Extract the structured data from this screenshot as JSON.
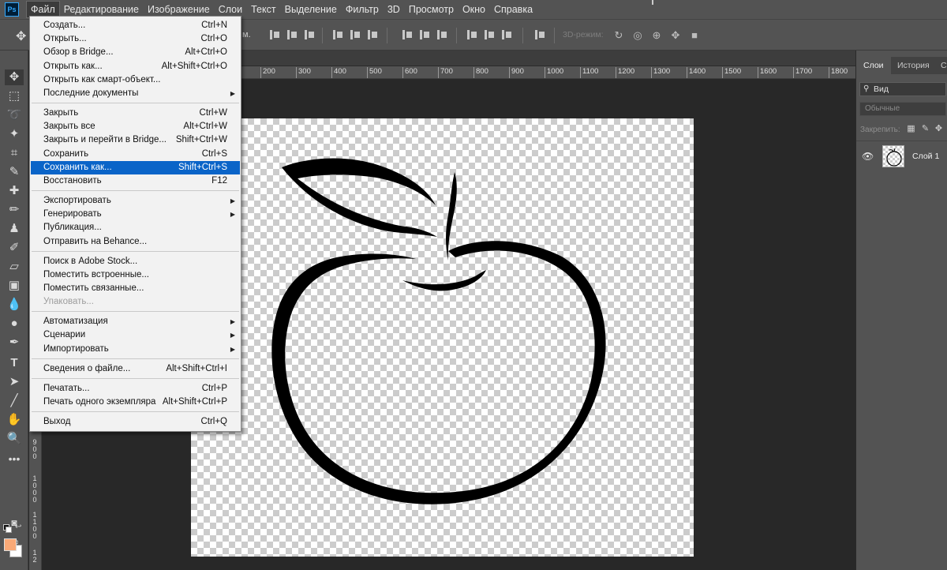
{
  "app": {
    "logo_text": "Ps"
  },
  "menubar": {
    "items": [
      "Файл",
      "Редактирование",
      "Изображение",
      "Слои",
      "Текст",
      "Выделение",
      "Фильтр",
      "3D",
      "Просмотр",
      "Окно",
      "Справка"
    ],
    "active_index": 0
  },
  "options_bar": {
    "dot_label": "м.",
    "mode_3d_label": "3D-режим:"
  },
  "file_menu": {
    "items": [
      {
        "label": "Создать...",
        "shortcut": "Ctrl+N"
      },
      {
        "label": "Открыть...",
        "shortcut": "Ctrl+O"
      },
      {
        "label": "Обзор в Bridge...",
        "shortcut": "Alt+Ctrl+O"
      },
      {
        "label": "Открыть как...",
        "shortcut": "Alt+Shift+Ctrl+O"
      },
      {
        "label": "Открыть как смарт-объект...",
        "shortcut": ""
      },
      {
        "label": "Последние документы",
        "shortcut": "",
        "submenu": true
      },
      {
        "label": "Закрыть",
        "shortcut": "Ctrl+W"
      },
      {
        "label": "Закрыть все",
        "shortcut": "Alt+Ctrl+W"
      },
      {
        "label": "Закрыть и перейти в Bridge...",
        "shortcut": "Shift+Ctrl+W"
      },
      {
        "label": "Сохранить",
        "shortcut": "Ctrl+S"
      },
      {
        "label": "Сохранить как...",
        "shortcut": "Shift+Ctrl+S",
        "highlighted": true
      },
      {
        "label": "Восстановить",
        "shortcut": "F12"
      },
      {
        "label": "Экспортировать",
        "shortcut": "",
        "submenu": true
      },
      {
        "label": "Генерировать",
        "shortcut": "",
        "submenu": true
      },
      {
        "label": "Публикация...",
        "shortcut": ""
      },
      {
        "label": "Отправить на Behance...",
        "shortcut": ""
      },
      {
        "label": "Поиск в Adobe Stock...",
        "shortcut": ""
      },
      {
        "label": "Поместить встроенные...",
        "shortcut": ""
      },
      {
        "label": "Поместить связанные...",
        "shortcut": ""
      },
      {
        "label": "Упаковать...",
        "shortcut": "",
        "disabled": true
      },
      {
        "label": "Автоматизация",
        "shortcut": "",
        "submenu": true
      },
      {
        "label": "Сценарии",
        "shortcut": "",
        "submenu": true
      },
      {
        "label": "Импортировать",
        "shortcut": "",
        "submenu": true
      },
      {
        "label": "Сведения о файле...",
        "shortcut": "Alt+Shift+Ctrl+I"
      },
      {
        "label": "Печатать...",
        "shortcut": "Ctrl+P"
      },
      {
        "label": "Печать одного экземпляра",
        "shortcut": "Alt+Shift+Ctrl+P"
      },
      {
        "label": "Выход",
        "shortcut": "Ctrl+Q"
      }
    ]
  },
  "ruler": {
    "h_ticks": [
      "200",
      "300",
      "400",
      "500",
      "600",
      "700",
      "800",
      "900",
      "1000",
      "1100",
      "1200",
      "1300",
      "1400",
      "1500",
      "1600",
      "1700",
      "1800"
    ],
    "v_ticks": [
      "9 0 0",
      "1 0 0 0",
      "1 1 0 0",
      "1 2"
    ]
  },
  "layers_panel": {
    "tabs": [
      "Слои",
      "История",
      "С"
    ],
    "active_tab": 0,
    "filter_label": "Вид",
    "blend_mode": "Обычные",
    "lock_label": "Закрепить:",
    "layers": [
      {
        "name": "Слой 1",
        "visible": true
      }
    ]
  },
  "colors": {
    "foreground": "#f9a977",
    "background": "#ffffff",
    "menu_highlight": "#0a64c8",
    "ui_panel": "#535353",
    "workspace": "#282828"
  }
}
